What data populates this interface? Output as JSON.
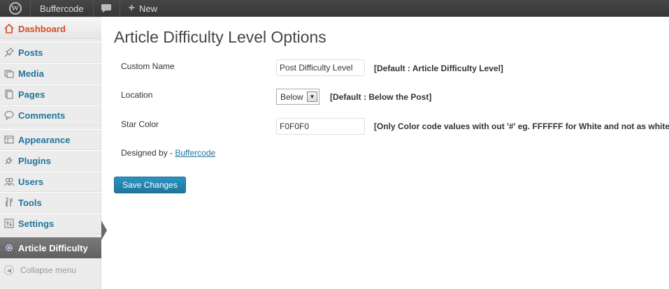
{
  "adminbar": {
    "logo_icon": "wordpress-logo-icon",
    "logo_glyph": "W",
    "site_name": "Buffercode",
    "comments_icon": "comment-bubble-icon",
    "new_label": "New"
  },
  "sidebar": {
    "items": [
      {
        "label": "Dashboard",
        "icon": "home-icon"
      },
      {
        "label": "Posts",
        "icon": "pin-icon"
      },
      {
        "label": "Media",
        "icon": "media-icon"
      },
      {
        "label": "Pages",
        "icon": "pages-icon"
      },
      {
        "label": "Comments",
        "icon": "comment-icon"
      },
      {
        "label": "Appearance",
        "icon": "appearance-icon"
      },
      {
        "label": "Plugins",
        "icon": "plugin-icon"
      },
      {
        "label": "Users",
        "icon": "users-icon"
      },
      {
        "label": "Tools",
        "icon": "tools-icon"
      },
      {
        "label": "Settings",
        "icon": "settings-icon"
      },
      {
        "label": "Article Difficulty",
        "icon": "gear-icon"
      }
    ],
    "collapse_label": "Collapse menu"
  },
  "main": {
    "title": "Article Difficulty Level Options",
    "custom_name": {
      "label": "Custom Name",
      "value": "Post Difficulty Level",
      "hint": "[Default : Article Difficulty Level]"
    },
    "location": {
      "label": "Location",
      "selected": "Below",
      "hint": "[Default : Below the Post]"
    },
    "star_color": {
      "label": "Star Color",
      "value": "F0F0F0",
      "hint": "[Only Color code values with out '#' eg. FFFFFF for White and not as white]"
    },
    "designed_by": "Designed by - ",
    "designed_link": "Buffercode",
    "save_button": "Save Changes"
  },
  "colors": {
    "accent": "#21759b",
    "dashboard": "#d54e21",
    "active_menu": "#6a6a6a"
  }
}
